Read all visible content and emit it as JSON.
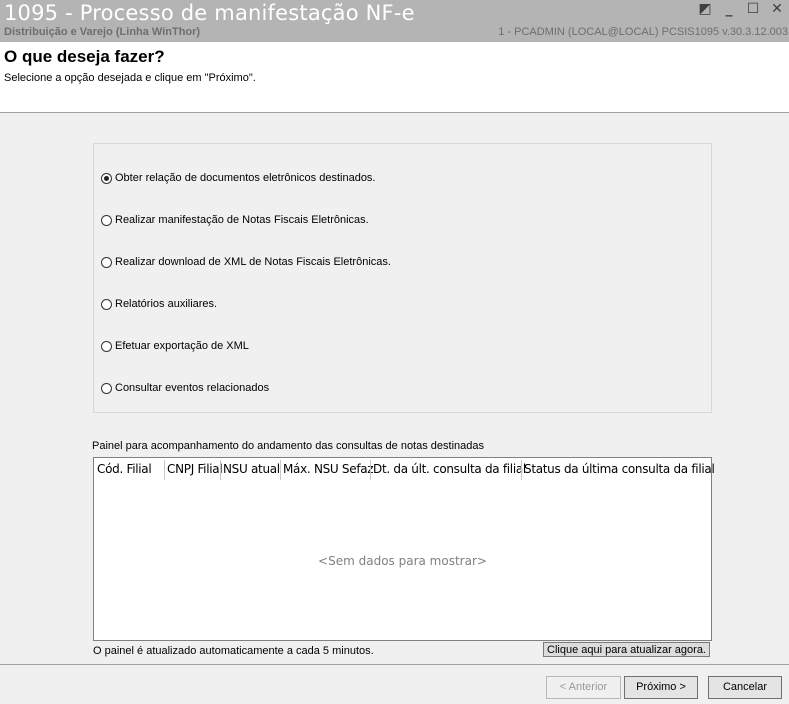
{
  "window": {
    "title": "1095 - Processo de manifestação NF-e",
    "subtitle": "Distribuição e Varejo (Linha WinThor)",
    "info": "1 - PCADMIN (LOCAL@LOCAL)   PCSIS1095  v.30.3.12.003",
    "controls": {
      "restore": "◩",
      "minimize": "_",
      "maximize": "☐",
      "close": "✕"
    }
  },
  "header": {
    "title": "O que deseja fazer?",
    "subtitle": "Selecione a opção desejada e clique em \"Próximo\"."
  },
  "options": [
    {
      "label": "Obter relação de documentos eletrônicos destinados.",
      "selected": true
    },
    {
      "label": "Realizar manifestação de Notas Fiscais Eletrônicas.",
      "selected": false
    },
    {
      "label": "Realizar download de XML de Notas Fiscais Eletrônicas.",
      "selected": false
    },
    {
      "label": "Relatórios auxiliares.",
      "selected": false
    },
    {
      "label": "Efetuar exportação de XML",
      "selected": false
    },
    {
      "label": "Consultar eventos relacionados",
      "selected": false
    }
  ],
  "panel": {
    "label": "Painel para acompanhamento do andamento das consultas de notas destinadas",
    "columns": [
      "Cód. Filial",
      "CNPJ Filial",
      "NSU atual",
      "Máx. NSU Sefaz",
      "Dt. da últ. consulta da filial",
      "Status da última consulta da filial"
    ],
    "empty_text": "<Sem dados para mostrar>",
    "footnote": "O painel é atualizado automaticamente a cada 5 minutos.",
    "refresh_label": "Clique aqui para atualizar agora."
  },
  "buttons": {
    "back": "< Anterior",
    "next": "Próximo >",
    "cancel": "Cancelar"
  }
}
